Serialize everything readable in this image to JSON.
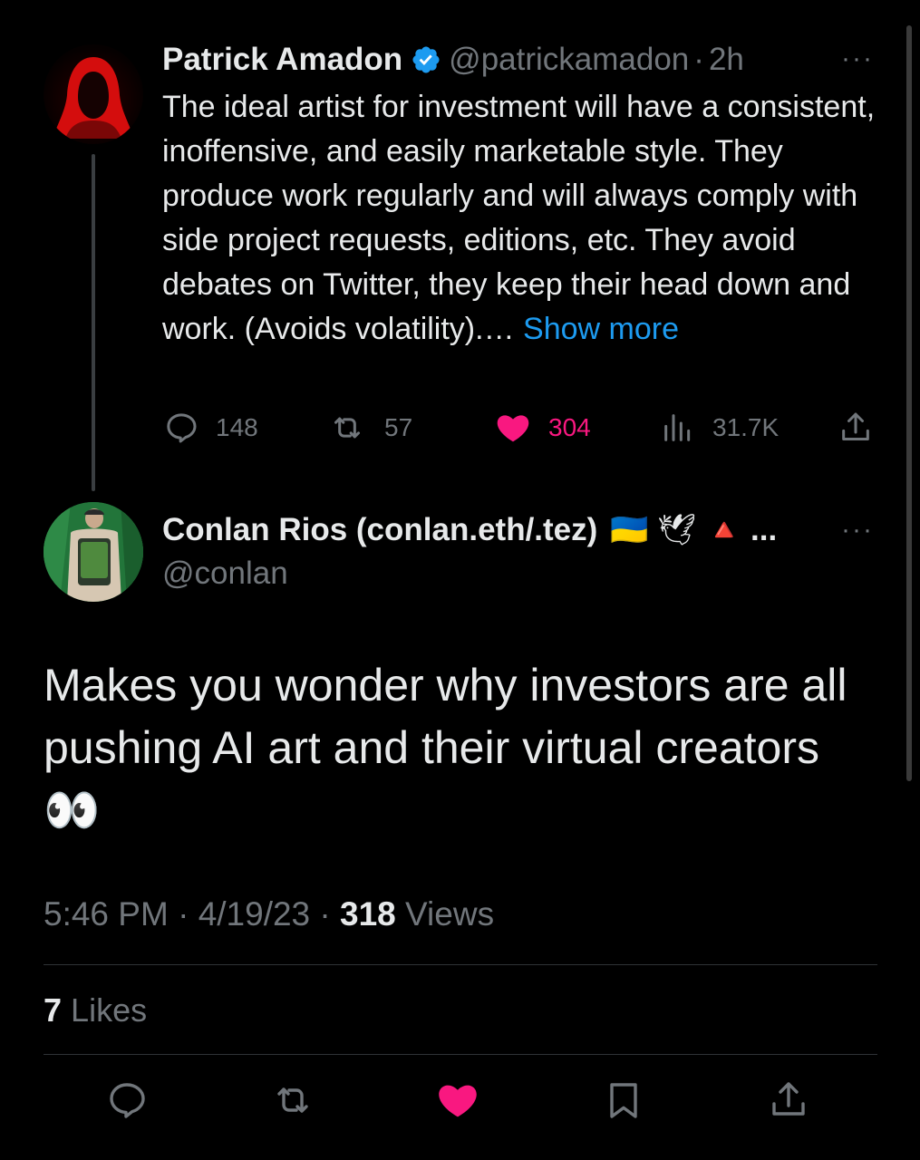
{
  "parent_tweet": {
    "author_name": "Patrick Amadon",
    "handle": "@patrickamadon",
    "separator": "·",
    "time": "2h",
    "more": "···",
    "text": "The ideal artist for investment will have a consistent, inoffensive, and easily marketable style. They produce work regularly and will always comply with side project requests, editions, etc. They avoid debates on Twitter, they keep their head down and work. (Avoids volatility).…",
    "show_more": "Show more",
    "stats": {
      "replies": "148",
      "retweets": "57",
      "likes": "304",
      "views": "31.7K"
    },
    "verified_color": "#1d9bf0"
  },
  "main_tweet": {
    "author_name": "Conlan Rios (conlan.eth/.tez)",
    "name_emojis": "🇺🇦 🕊 🔺",
    "name_ellipsis": "...",
    "handle": "@conlan",
    "more": "···",
    "text": "Makes you wonder why investors are all pushing AI art and their virtual creators",
    "text_emoji": "👀",
    "time": "5:46 PM",
    "sep1": "·",
    "date": "4/19/23",
    "sep2": "·",
    "views_count": "318",
    "views_label": "Views",
    "likes_count": "7",
    "likes_label": "Likes"
  },
  "colors": {
    "background": "#000000",
    "text": "#e7e9ea",
    "muted": "#71767b",
    "link": "#1d9bf0",
    "like": "#f91880"
  },
  "icons": {
    "reply": "reply-bubble-icon",
    "retweet": "retweet-icon",
    "like": "heart-icon",
    "views": "views-bar-chart-icon",
    "share": "share-upload-icon",
    "bookmark": "bookmark-icon"
  }
}
